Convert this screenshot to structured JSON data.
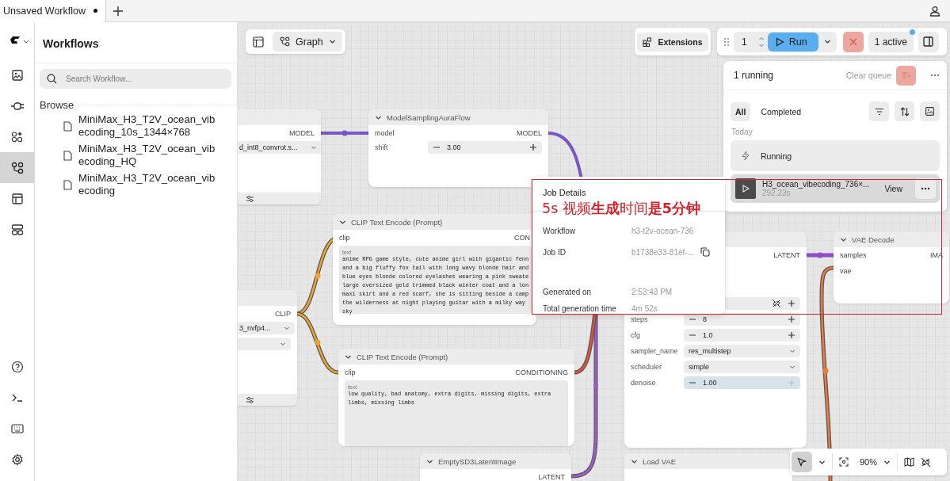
{
  "tabs": [
    {
      "label": "Unsaved Workflow",
      "modified": true,
      "selected": true
    }
  ],
  "sidebar": {
    "items": [
      {
        "kind": "images",
        "selected": false
      },
      {
        "kind": "models",
        "selected": false
      },
      {
        "kind": "nodes",
        "selected": false
      },
      {
        "kind": "workflows",
        "selected": true
      },
      {
        "kind": "templates",
        "selected": false
      },
      {
        "kind": "apps",
        "selected": false
      }
    ],
    "bottom_items": [
      {
        "kind": "help"
      },
      {
        "kind": "terminal"
      },
      {
        "kind": "keyboard"
      },
      {
        "kind": "settings"
      }
    ]
  },
  "workflows_panel": {
    "title": "Workflows",
    "search": {
      "placeholder": "Search Workflow..."
    },
    "section": "Browse",
    "files": [
      "MiniMax_H3_T2V_ocean_vibecoding_10s_1344×768",
      "MiniMax_H3_T2V_ocean_vibecoding_HQ",
      "MiniMax_H3_T2V_ocean_vibecoding"
    ]
  },
  "canvas_toolbar": {
    "view_mode": "Graph",
    "zoom": "90%"
  },
  "top_actions": {
    "extensions": "Extensions",
    "run_count": "1",
    "run": "Run",
    "active": "1 active",
    "active_dot": true
  },
  "queue": {
    "title": "1 running",
    "clear": "Clear queue",
    "filters": [
      {
        "label": "All",
        "selected": true
      },
      {
        "label": "Completed",
        "selected": false
      }
    ],
    "group": "Today",
    "running": "Running",
    "jobs": [
      {
        "name": "H3_ocean_vibecoding_736×...",
        "time": "292.23s",
        "action": "View"
      }
    ]
  },
  "job_details": {
    "title": "Job Details",
    "rows": [
      {
        "label": "Workflow",
        "value": "h3-t2v-ocean-736",
        "copy": false
      },
      {
        "label": "Job ID",
        "value": "b1738e33-81ef-...",
        "copy": true
      },
      {
        "label": "Generated on",
        "value": "2:53:43 PM",
        "copy": false
      },
      {
        "label": "Total generation time",
        "value": "4m 52s",
        "copy": false
      }
    ]
  },
  "annotation": {
    "text": "5s 视频**生成**时间**是5分钟**"
  },
  "nodes": [
    {
      "kind": "loader",
      "outputs": [
        "MODEL"
      ],
      "widgets": [
        {
          "kind": "select",
          "value": "d_int8_convrot.s..."
        }
      ]
    },
    {
      "kind": "node",
      "title": "ModelSamplingAuraFlow",
      "inputs": [
        "model"
      ],
      "outputs": [
        "MODEL"
      ],
      "widgets": [
        {
          "kind": "number",
          "label": "shift",
          "value": "3.00"
        }
      ]
    },
    {
      "kind": "node",
      "title": "CLIP Text Encode (Prompt)",
      "inputs": [
        "clip"
      ],
      "outputs": [
        "CON"
      ],
      "widgets": [
        {
          "kind": "text",
          "label": "text",
          "lines": [
            "anime RPG game style, cute anime girl with gigantic fenn",
            "and a big fluffy fox tail with long wavy blonde hair and",
            "blue eyes blonde colored eyelashes wearing a pink sweate",
            "large oversized gold trimmed black winter coat and a lon",
            "maxi skirt and a red scarf, she is sitting beside a camp",
            "the wilderness at night playing guitar with a milky way",
            "sky"
          ]
        }
      ]
    },
    {
      "kind": "loader",
      "outputs": [
        "CLIP"
      ],
      "widgets": [
        {
          "kind": "select",
          "value": "3_nvfp4..."
        },
        {
          "kind": "select"
        }
      ]
    },
    {
      "kind": "node",
      "title": "CLIP Text Encode (Prompt)",
      "inputs": [
        "clip"
      ],
      "outputs": [
        "CONDITIONING"
      ],
      "widgets": [
        {
          "kind": "text",
          "label": "text",
          "lines": [
            "low quality, bad anatomy, extra digits, missing digits, extra",
            "limbs, missing limbs"
          ]
        }
      ]
    },
    {
      "kind": "node",
      "title": "EmptySD3LatentImage",
      "outputs": [
        "LATENT"
      ]
    },
    {
      "kind": "node",
      "outputs": [
        "LATENT"
      ],
      "widgets": [
        {
          "kind": "toolrow"
        },
        {
          "kind": "number",
          "label": "steps",
          "value": "8"
        },
        {
          "kind": "number",
          "label": "cfg",
          "value": "1.0"
        },
        {
          "kind": "select",
          "label": "sampler_name",
          "value": "res_multistep"
        },
        {
          "kind": "select",
          "label": "scheduler",
          "value": "simple"
        },
        {
          "kind": "number",
          "label": "denoise",
          "value": "1.00",
          "focused": true
        }
      ]
    },
    {
      "kind": "node",
      "title": "VAE Decode",
      "inputs": [
        "samples",
        "vae"
      ],
      "outputs": [
        "IMA"
      ]
    },
    {
      "kind": "node",
      "title": "Load VAE"
    }
  ]
}
